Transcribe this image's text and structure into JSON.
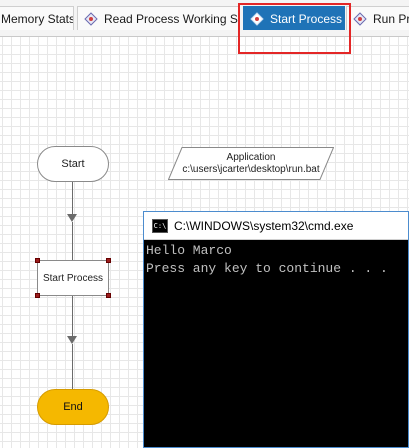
{
  "tabs": [
    {
      "label": "Memory Stats",
      "active": false,
      "icon": "none"
    },
    {
      "label": "Read Process Working Set",
      "active": false,
      "icon": "process-diamond-icon"
    },
    {
      "label": "Start Process",
      "active": true,
      "icon": "process-diamond-icon"
    },
    {
      "label": "Run Pro",
      "active": false,
      "icon": "process-diamond-icon"
    }
  ],
  "flowchart": {
    "start_label": "Start",
    "process_label": "Start Process",
    "end_label": "End",
    "parameter": {
      "title": "Application",
      "value": "c:\\users\\jcarter\\desktop\\run.bat"
    }
  },
  "console": {
    "title": "C:\\WINDOWS\\system32\\cmd.exe",
    "icon_text": "C:\\",
    "lines": [
      "Hello Marco",
      "Press any key to continue . . ."
    ]
  },
  "colors": {
    "active_tab": "#1f73b7",
    "highlight": "#e32626",
    "end_node": "#f5b800",
    "console_bg": "#000000"
  }
}
